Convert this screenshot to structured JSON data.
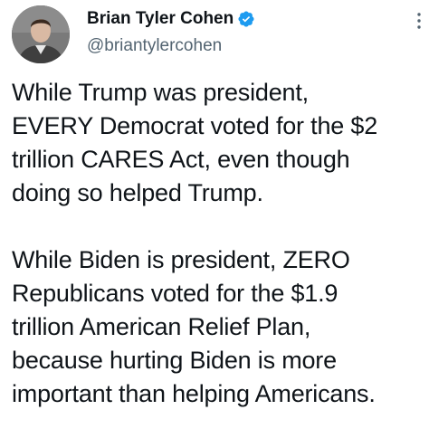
{
  "author": {
    "display_name": "Brian Tyler Cohen",
    "handle": "@briantylercohen",
    "verified": true,
    "avatar_icon": "profile-photo"
  },
  "tweet": {
    "paragraphs": [
      "While Trump was president,\nEVERY Democrat voted for the $2\ntrillion CARES Act, even though\ndoing so helped Trump.",
      "While Biden is president, ZERO\nRepublicans voted for the $1.9\ntrillion American Relief Plan,\nbecause hurting Biden is more\nimportant than helping Americans."
    ]
  },
  "icons": {
    "verified": "verified-badge-icon",
    "more": "more-options-icon"
  },
  "colors": {
    "verified_blue": "#1d9bf0",
    "text_primary": "#0f1419",
    "text_secondary": "#536471"
  }
}
